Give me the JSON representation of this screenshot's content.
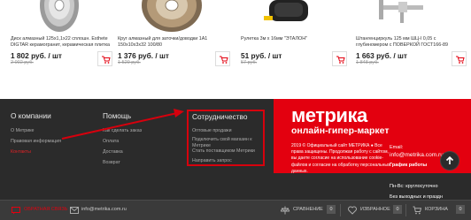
{
  "products": [
    {
      "name": "Диск алмазный 125х1,1х22 сплошн. Esthete DIGTAR керамогранит, керамическая плитка",
      "price": "1 802 руб. / шт",
      "old_price": "2 002 руб.",
      "thumb": "diamond-disc-image"
    },
    {
      "name": "Круг алмазный для заточки/доводки 1А1 150х10х3х32 100/80",
      "price": "1 376 руб. / шт",
      "old_price": "1 529 руб.",
      "thumb": "grinding-wheel-image"
    },
    {
      "name": "Рулетка 3м х 16мм \"ЭТАЛОН\"",
      "price": "51 руб. / шт",
      "old_price": "57 руб.",
      "thumb": "tape-measure-image"
    },
    {
      "name": "Штангенциркуль 125 мм ШЦ-I 0,05 с глубиномером с ПОВЕРКОЙ ГОСТ166-89",
      "price": "1 663 руб. / шт",
      "old_price": "1 848 руб.",
      "thumb": "caliper-image"
    }
  ],
  "footer": {
    "about": {
      "title": "О компании",
      "links": [
        "О Метрике",
        "Правовая информация",
        "Контакты"
      ]
    },
    "help": {
      "title": "Помощь",
      "links": [
        "Как сделать заказ",
        "Оплата",
        "Доставка",
        "Возврат"
      ]
    },
    "coop": {
      "title": "Сотрудничество",
      "links": [
        "Оптовые продажи",
        "Подключить свой магазин к Метрике",
        "Стать поставщиком Метрики",
        "Направить запрос"
      ]
    }
  },
  "brand": {
    "logo": "метрика",
    "sub": "онлайн-гипер-маркет",
    "text": "2019 © Официальный сайт МЕТРИКА ● Все права защищены. Продолжая работу с сайтом, вы даете согласие на использование cookie-файлов и согласие на обработку персональных данных.",
    "email_label": "Email:",
    "email": "info@metrika.com.ru",
    "hours_label": "График работы",
    "hours_days": "Пн-Вс: круглосуточно",
    "hours_note": "Без выходных и праздн"
  },
  "bottombar": {
    "feedback": "ОБРАТНАЯ СВЯЗЬ",
    "email": "info@metrika.com.ru",
    "compare": "СРАВНЕНИЕ",
    "compare_count": "0",
    "favorites": "ИЗБРАННОЕ",
    "favorites_count": "0",
    "cart": "КОРЗИНА",
    "cart_count": "0"
  },
  "colors": {
    "accent": "#e3000f",
    "footer_bg": "#2b2b2b",
    "bottombar_bg": "#3a3a3a"
  }
}
